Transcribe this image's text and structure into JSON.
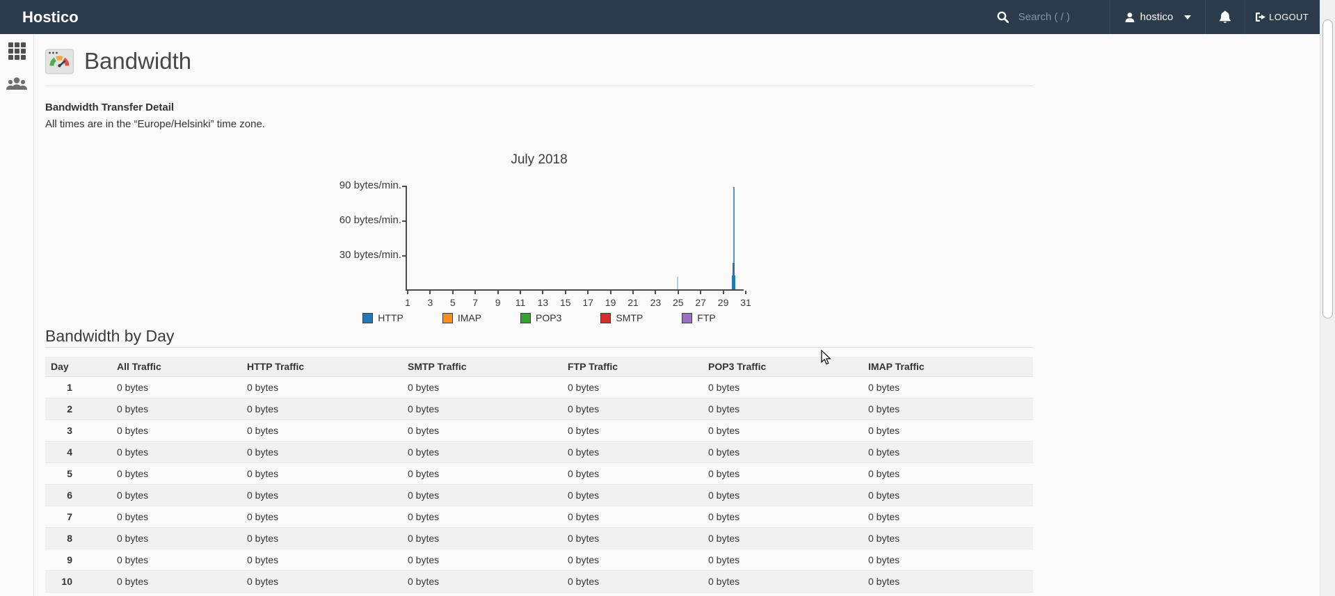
{
  "navbar": {
    "brand": "Hostico",
    "search_placeholder": "Search ( / )",
    "username": "hostico",
    "logout_label": "LOGOUT"
  },
  "sidebar": {
    "items": [
      {
        "icon": "apps-grid-icon"
      },
      {
        "icon": "user-manager-icon"
      }
    ]
  },
  "page": {
    "title": "Bandwidth",
    "section_heading": "Bandwidth Transfer Detail",
    "timezone_note": "All times are in the “Europe/Helsinki” time zone.",
    "table_heading": "Bandwidth by Day"
  },
  "icons": {
    "search-icon": "magnifier",
    "user-icon": "person silhouette",
    "caret-down-icon": "triangle",
    "bell-icon": "bell",
    "logout-icon": "sign-out",
    "apps-grid-icon": "3x3 grid",
    "user-manager-icon": "people group",
    "bandwidth-icon": "browser window with speed gauge"
  },
  "colors": {
    "navbar_bg": "#2b3b4c",
    "axis": "#4a4a4a",
    "spike_light": "#a9cee6",
    "spike_line": "#4e96c8",
    "spike_dark": "#2878ae",
    "row_stripe": "#f1f1f1",
    "header_bg": "#f0f0f0"
  },
  "chart_data": {
    "type": "bar",
    "title": "July 2018",
    "x_range": [
      1,
      31
    ],
    "x_tick_labels": [
      "1",
      "3",
      "5",
      "7",
      "9",
      "11",
      "13",
      "15",
      "17",
      "19",
      "21",
      "23",
      "25",
      "27",
      "29",
      "31"
    ],
    "y_unit": "bytes/min.",
    "y_ticks": [
      "30 bytes/min.",
      "60 bytes/min.",
      "90 bytes/min."
    ],
    "y_tick_values": [
      30,
      60,
      90
    ],
    "y_max": 95,
    "series": [
      {
        "name": "HTTP",
        "values": [
          0,
          0,
          0,
          0,
          0,
          0,
          0,
          0,
          0,
          0,
          0,
          0,
          0,
          0,
          0,
          0,
          0,
          0,
          0,
          0,
          0,
          0,
          0,
          0,
          11,
          0,
          0,
          0,
          0,
          88,
          0
        ]
      }
    ],
    "spikes": [
      {
        "day": 25,
        "peak": 11,
        "color": "#a9cee6"
      },
      {
        "day": 30,
        "peak": 88,
        "mid": 23,
        "base": 12,
        "line_color": "#4e96c8",
        "bar_color": "#2878ae"
      }
    ],
    "legend": [
      {
        "label": "HTTP",
        "color": "#2478b5"
      },
      {
        "label": "IMAP",
        "color": "#ff8d1e"
      },
      {
        "label": "POP3",
        "color": "#33a333"
      },
      {
        "label": "SMTP",
        "color": "#d62d2d"
      },
      {
        "label": "FTP",
        "color": "#9b6fc3"
      }
    ]
  },
  "table": {
    "columns": [
      "Day",
      "All Traffic",
      "HTTP Traffic",
      "SMTP Traffic",
      "FTP Traffic",
      "POP3 Traffic",
      "IMAP Traffic"
    ],
    "rows": [
      [
        "1",
        "0 bytes",
        "0 bytes",
        "0 bytes",
        "0 bytes",
        "0 bytes",
        "0 bytes"
      ],
      [
        "2",
        "0 bytes",
        "0 bytes",
        "0 bytes",
        "0 bytes",
        "0 bytes",
        "0 bytes"
      ],
      [
        "3",
        "0 bytes",
        "0 bytes",
        "0 bytes",
        "0 bytes",
        "0 bytes",
        "0 bytes"
      ],
      [
        "4",
        "0 bytes",
        "0 bytes",
        "0 bytes",
        "0 bytes",
        "0 bytes",
        "0 bytes"
      ],
      [
        "5",
        "0 bytes",
        "0 bytes",
        "0 bytes",
        "0 bytes",
        "0 bytes",
        "0 bytes"
      ],
      [
        "6",
        "0 bytes",
        "0 bytes",
        "0 bytes",
        "0 bytes",
        "0 bytes",
        "0 bytes"
      ],
      [
        "7",
        "0 bytes",
        "0 bytes",
        "0 bytes",
        "0 bytes",
        "0 bytes",
        "0 bytes"
      ],
      [
        "8",
        "0 bytes",
        "0 bytes",
        "0 bytes",
        "0 bytes",
        "0 bytes",
        "0 bytes"
      ],
      [
        "9",
        "0 bytes",
        "0 bytes",
        "0 bytes",
        "0 bytes",
        "0 bytes",
        "0 bytes"
      ],
      [
        "10",
        "0 bytes",
        "0 bytes",
        "0 bytes",
        "0 bytes",
        "0 bytes",
        "0 bytes"
      ]
    ]
  }
}
